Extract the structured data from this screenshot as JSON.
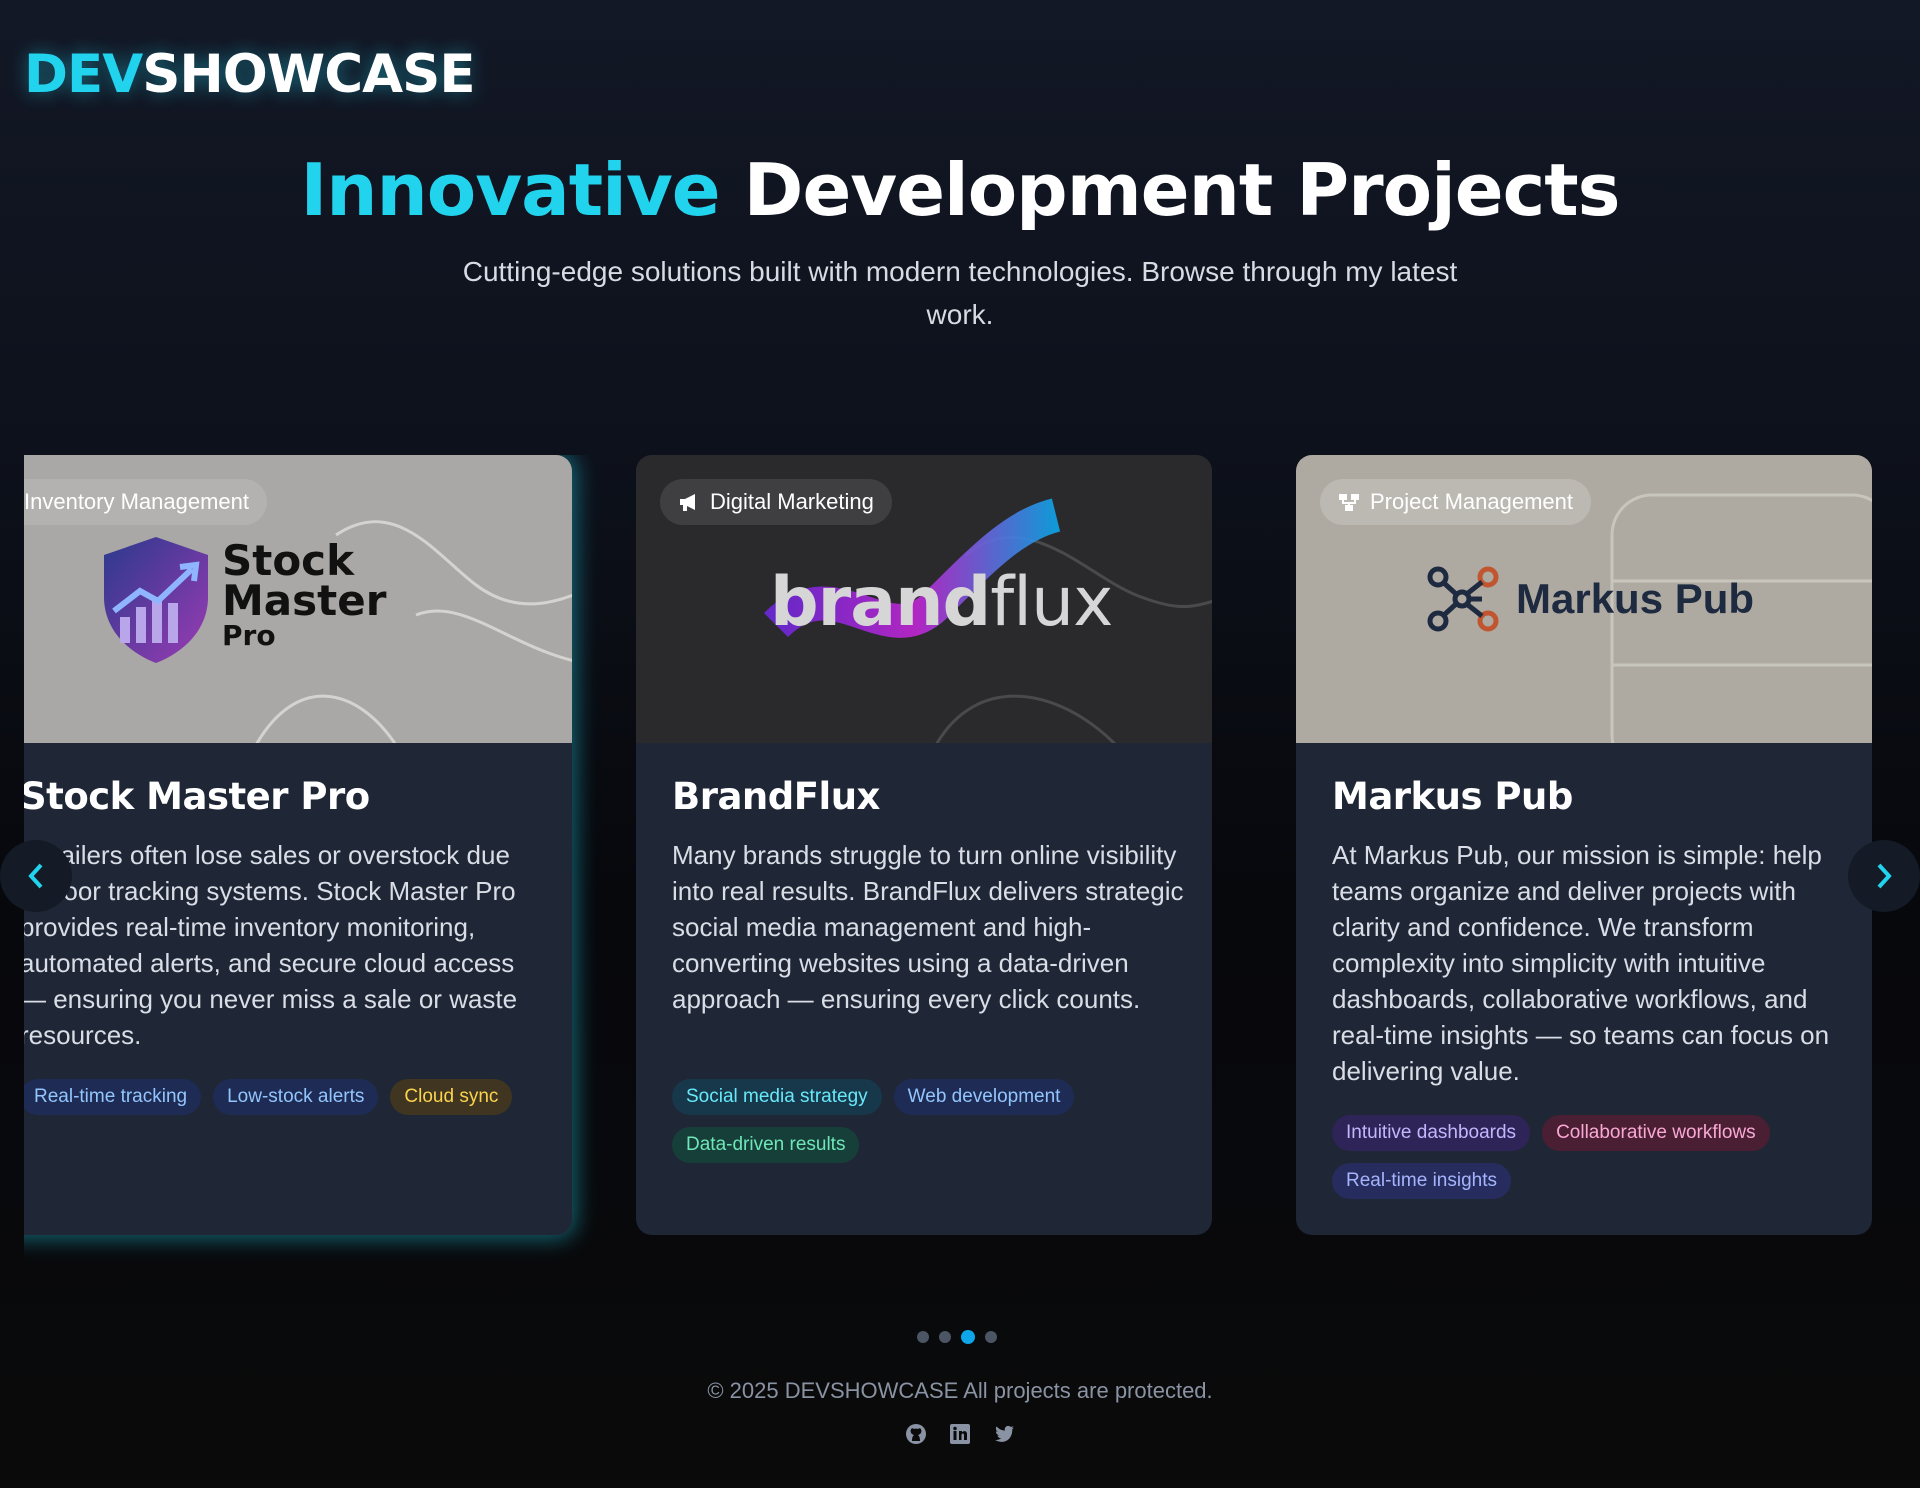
{
  "logo": {
    "accent": "DEV",
    "rest": "SHOWCASE"
  },
  "hero": {
    "title_accent": "Innovative",
    "title_rest": " Development Projects",
    "subtitle": "Cutting-edge solutions built with modern technologies. Browse through my latest work."
  },
  "projects": [
    {
      "category": "Inventory Management",
      "category_icon": "chart-line-icon",
      "brand_line1": "Stock",
      "brand_line2": "Master",
      "brand_line3": "Pro",
      "title": "Stock Master Pro",
      "description": "Retailers often lose sales or overstock due to poor tracking systems. Stock Master Pro provides real-time inventory monitoring, automated alerts, and secure cloud access — ensuring you never miss a sale or waste resources.",
      "tags": [
        "Real-time tracking",
        "Low-stock alerts",
        "Cloud sync"
      ]
    },
    {
      "category": "Digital Marketing",
      "category_icon": "megaphone-icon",
      "brand_a": "brand",
      "brand_b": "flux",
      "title": "BrandFlux",
      "description": "Many brands struggle to turn online visibility into real results. BrandFlux delivers strategic social media management and high-converting websites using a data-driven approach — ensuring every click counts.",
      "tags": [
        "Social media strategy",
        "Web development",
        "Data-driven results"
      ]
    },
    {
      "category": "Project Management",
      "category_icon": "sitemap-icon",
      "brand": "Markus Pub",
      "title": "Markus Pub",
      "description": "At Markus Pub, our mission is simple: help teams organize and deliver projects with clarity and confidence. We transform complexity into simplicity with intuitive dashboards, collaborative workflows, and real-time insights — so teams can focus on delivering value.",
      "tags": [
        "Intuitive dashboards",
        "Collaborative workflows",
        "Real-time insights"
      ]
    }
  ],
  "carousel": {
    "slides": 4,
    "active_slide": 3
  },
  "footer": {
    "copyright": "© 2025 DEVSHOWCASE All projects are protected."
  },
  "social_icons": [
    "github-icon",
    "linkedin-icon",
    "twitter-icon"
  ],
  "colors": {
    "accent": "#22d3ee",
    "card_bg": "#1f2636",
    "dot_active": "#0ea5e9"
  }
}
